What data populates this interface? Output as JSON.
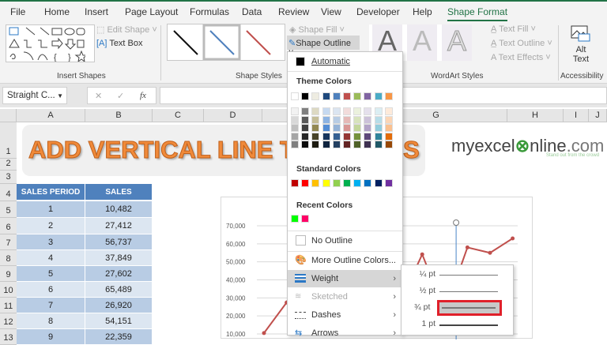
{
  "tabs": [
    "File",
    "Home",
    "Insert",
    "Page Layout",
    "Formulas",
    "Data",
    "Review",
    "View",
    "Developer",
    "Help",
    "Shape Format"
  ],
  "ribbon": {
    "edit_shape": "Edit Shape",
    "text_box": "Text Box",
    "insert_shapes": "Insert Shapes",
    "shape_styles": "Shape Styles",
    "shape_fill": "Shape Fill",
    "shape_outline": "Shape Outline",
    "text_fill": "Text Fill",
    "text_outline": "Text Outline",
    "text_effects": "Text Effects",
    "wordart_styles": "WordArt Styles",
    "alt_text_1": "Alt",
    "alt_text_2": "Text",
    "accessibility": "Accessibility",
    "wordart_letter": "A"
  },
  "formula_bar": {
    "name_box": "Straight C...",
    "cancel": "✕",
    "enter": "✓",
    "fx": "fx",
    "value": ""
  },
  "columns": [
    "A",
    "B",
    "C",
    "D",
    "G",
    "H",
    "I",
    "J"
  ],
  "rows": [
    "1",
    "2",
    "3",
    "4",
    "5",
    "6",
    "7",
    "8",
    "9",
    "10",
    "11",
    "12",
    "13"
  ],
  "banner": {
    "title": "ADD VERTICAL LINE T",
    "title_end": "S",
    "logo_a": "myexcel",
    "logo_b": "nline",
    "logo_c": ".com",
    "logo_tag": "Stand out from the crowd"
  },
  "table": {
    "headers": [
      "SALES PERIOD",
      "SALES"
    ],
    "rows": [
      [
        "1",
        "10,482"
      ],
      [
        "2",
        "27,412"
      ],
      [
        "3",
        "56,737"
      ],
      [
        "4",
        "37,849"
      ],
      [
        "5",
        "27,602"
      ],
      [
        "6",
        "65,489"
      ],
      [
        "7",
        "26,920"
      ],
      [
        "8",
        "54,151"
      ],
      [
        "9",
        "22,359"
      ]
    ]
  },
  "chart": {
    "y_ticks": [
      "70,000",
      "60,000",
      "50,000",
      "40,000",
      "30,000",
      "20,000",
      "10,000"
    ],
    "series_color": "#c0504d",
    "vline_color": "#4a86c8",
    "points": [
      10482,
      27412,
      56737,
      37849,
      27602,
      65489,
      26920,
      54151,
      22359,
      58000,
      55000,
      63000
    ],
    "vline_period": 9.5
  },
  "menu": {
    "automatic": "Automatic",
    "theme_colors": "Theme Colors",
    "theme_top": [
      "#ffffff",
      "#000000",
      "#eeece1",
      "#1f497d",
      "#4f81bd",
      "#c0504d",
      "#9bbb59",
      "#8064a2",
      "#4bacc6",
      "#f79646"
    ],
    "theme_shades": [
      [
        "#f2f2f2",
        "#d8d8d8",
        "#bfbfbf",
        "#a5a5a5",
        "#7f7f7f"
      ],
      [
        "#7f7f7f",
        "#595959",
        "#3f3f3f",
        "#262626",
        "#0c0c0c"
      ],
      [
        "#ddd9c3",
        "#c4bd97",
        "#938953",
        "#494429",
        "#1d1b10"
      ],
      [
        "#c6d9f0",
        "#8db3e2",
        "#548dd4",
        "#17365d",
        "#0f243e"
      ],
      [
        "#dbe5f1",
        "#b8cce4",
        "#95b3d7",
        "#366092",
        "#244061"
      ],
      [
        "#f2dcdb",
        "#e5b9b7",
        "#d99694",
        "#953734",
        "#632423"
      ],
      [
        "#ebf1dd",
        "#d7e3bc",
        "#c3d69b",
        "#76923c",
        "#4f6128"
      ],
      [
        "#e5e0ec",
        "#ccc1d9",
        "#b2a2c7",
        "#5f497a",
        "#3f3151"
      ],
      [
        "#dbeef3",
        "#b7dde8",
        "#92cddc",
        "#31859b",
        "#205867"
      ],
      [
        "#fdeada",
        "#fbd5b5",
        "#fac08f",
        "#e36c09",
        "#974806"
      ]
    ],
    "standard_colors_label": "Standard Colors",
    "standard": [
      "#c00000",
      "#ff0000",
      "#ffc000",
      "#ffff00",
      "#92d050",
      "#00b050",
      "#00b0f0",
      "#0070c0",
      "#002060",
      "#7030a0"
    ],
    "recent_colors_label": "Recent Colors",
    "recent": [
      "#00ff00",
      "#ff0066"
    ],
    "no_outline": "No Outline",
    "more_colors": "More Outline Colors...",
    "weight": "Weight",
    "sketched": "Sketched",
    "dashes": "Dashes",
    "arrows": "Arrows"
  },
  "weights": [
    "¼ pt",
    "½ pt",
    "¾ pt",
    "1 pt"
  ]
}
